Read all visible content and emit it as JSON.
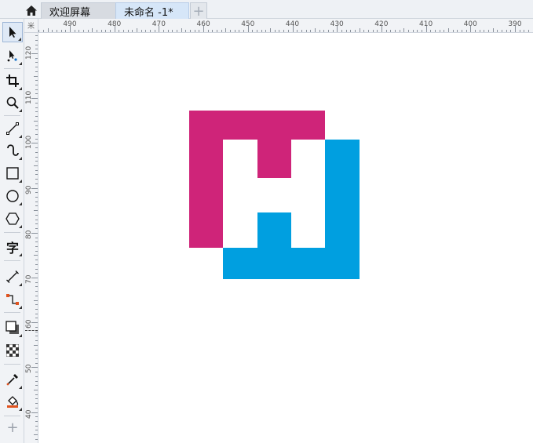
{
  "tabs": {
    "home_icon": "home-icon",
    "welcome_label": "欢迎屏幕",
    "document_label": "未命名 -1*",
    "add_label": "+"
  },
  "toolbox": {
    "tools": [
      "pick-tool-icon",
      "shape-tool-icon",
      "crop-tool-icon",
      "zoom-tool-icon",
      "freehand-tool-icon",
      "artistic-media-tool-icon",
      "rectangle-tool-icon",
      "ellipse-tool-icon",
      "polygon-tool-icon",
      "text-tool-icon",
      "dimension-tool-icon",
      "connector-tool-icon",
      "drop-shadow-tool-icon",
      "transparency-tool-icon",
      "eyedropper-tool-icon",
      "interactive-fill-tool-icon",
      "add-tool-icon"
    ],
    "text_tool_glyph": "字",
    "add_glyph": "+"
  },
  "ruler": {
    "unit_glyph": "米",
    "horizontal_labels": [
      "490",
      "480",
      "470",
      "460",
      "450",
      "440",
      "430",
      "420",
      "410",
      "400",
      "390"
    ],
    "vertical_labels": [
      "120",
      "110",
      "100",
      "90",
      "80",
      "70",
      "60",
      "50",
      "40"
    ]
  },
  "logo": {
    "magenta": "#cf2479",
    "blue": "#009fe0",
    "white": "#ffffff"
  }
}
